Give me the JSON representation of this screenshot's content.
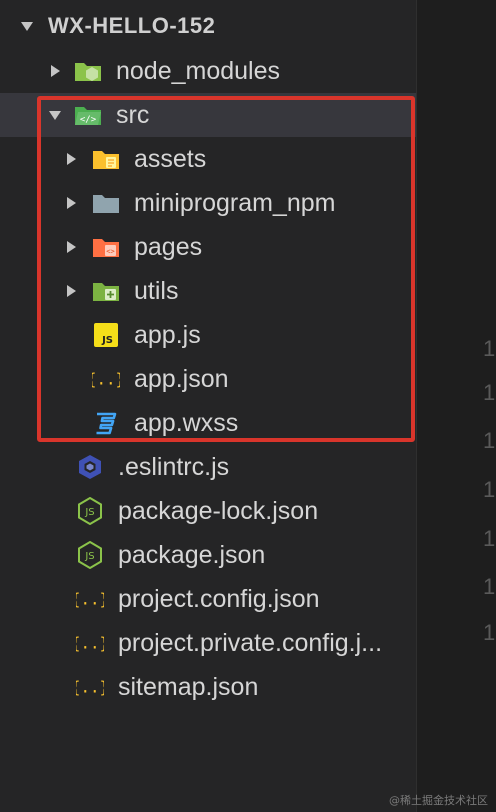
{
  "explorer": {
    "root": {
      "label": "WX-HELLO-152"
    },
    "items": [
      {
        "label": "node_modules",
        "icon": "node-modules-folder-icon"
      },
      {
        "label": "src",
        "icon": "src-folder-icon"
      },
      {
        "label": "assets",
        "icon": "assets-folder-icon"
      },
      {
        "label": "miniprogram_npm",
        "icon": "folder-icon"
      },
      {
        "label": "pages",
        "icon": "pages-folder-icon"
      },
      {
        "label": "utils",
        "icon": "utils-folder-icon"
      },
      {
        "label": "app.js",
        "icon": "js-file-icon"
      },
      {
        "label": "app.json",
        "icon": "json-file-icon"
      },
      {
        "label": "app.wxss",
        "icon": "css-file-icon"
      },
      {
        "label": ".eslintrc.js",
        "icon": "eslint-icon"
      },
      {
        "label": "package-lock.json",
        "icon": "nodejs-icon"
      },
      {
        "label": "package.json",
        "icon": "nodejs-icon"
      },
      {
        "label": "project.config.json",
        "icon": "json-file-icon"
      },
      {
        "label": "project.private.config.j...",
        "icon": "json-file-icon"
      },
      {
        "label": "sitemap.json",
        "icon": "json-file-icon"
      }
    ]
  },
  "editor": {
    "line_numbers": [
      "1",
      "1",
      "1",
      "1",
      "1",
      "1",
      "1"
    ]
  },
  "colors": {
    "highlight": "#d9352b",
    "background": "#252526"
  },
  "watermark": "@稀土掘金技术社区"
}
